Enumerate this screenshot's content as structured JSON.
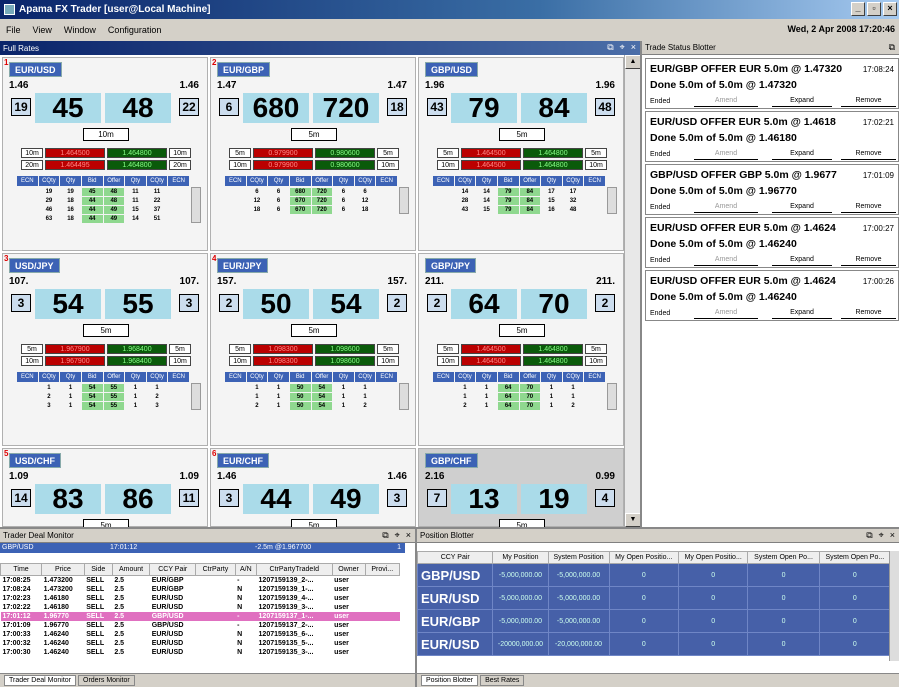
{
  "app": {
    "title": "Apama FX Trader [user@Local Machine]",
    "datetime": "Wed, 2 Apr 2008 17:20:46"
  },
  "menu": [
    "File",
    "View",
    "Window",
    "Configuration"
  ],
  "fullrates": {
    "title": "Full Rates",
    "tiles": [
      {
        "num": "1",
        "pair": "EUR/USD",
        "big_l": "1.46",
        "big_r": "1.46",
        "pip_l": "19",
        "bid": "45",
        "ask": "48",
        "pip_r": "22",
        "amount": "10m",
        "quotes": [
          [
            "10m",
            "1.464500",
            "1.464800",
            "10m"
          ],
          [
            "20m",
            "1.464495",
            "1.464800",
            "20m"
          ]
        ],
        "depth": [
          [
            "19",
            "19",
            "45",
            "48",
            "11",
            "11"
          ],
          [
            "29",
            "18",
            "44",
            "48",
            "11",
            "22"
          ],
          [
            "46",
            "16",
            "44",
            "49",
            "15",
            "37"
          ],
          [
            "63",
            "18",
            "44",
            "49",
            "14",
            "51"
          ]
        ],
        "gray": false
      },
      {
        "num": "2",
        "pair": "EUR/GBP",
        "big_l": "1.47",
        "big_r": "1.47",
        "pip_l": "6",
        "bid": "680",
        "ask": "720",
        "pip_r": "18",
        "amount": "5m",
        "quotes": [
          [
            "5m",
            "0.979900",
            "0.980600",
            "5m"
          ],
          [
            "10m",
            "0.979900",
            "0.980600",
            "10m"
          ]
        ],
        "depth": [
          [
            "6",
            "6",
            "680",
            "720",
            "6",
            "6"
          ],
          [
            "12",
            "6",
            "670",
            "720",
            "6",
            "12"
          ],
          [
            "18",
            "6",
            "670",
            "720",
            "6",
            "18"
          ]
        ],
        "gray": false
      },
      {
        "num": "",
        "pair": "GBP/USD",
        "big_l": "1.96",
        "big_r": "1.96",
        "pip_l": "43",
        "bid": "79",
        "ask": "84",
        "pip_r": "48",
        "amount": "5m",
        "quotes": [
          [
            "5m",
            "1.464500",
            "1.464800",
            "5m"
          ],
          [
            "10m",
            "1.464500",
            "1.464800",
            "10m"
          ]
        ],
        "depth": [
          [
            "14",
            "14",
            "79",
            "84",
            "17",
            "17"
          ],
          [
            "28",
            "14",
            "79",
            "84",
            "15",
            "32"
          ],
          [
            "43",
            "15",
            "79",
            "84",
            "16",
            "48"
          ]
        ],
        "gray": false
      },
      {
        "num": "3",
        "pair": "USD/JPY",
        "big_l": "107.",
        "big_r": "107.",
        "pip_l": "3",
        "bid": "54",
        "ask": "55",
        "pip_r": "3",
        "amount": "5m",
        "quotes": [
          [
            "5m",
            "1.967900",
            "1.968400",
            "5m"
          ],
          [
            "10m",
            "1.967900",
            "1.968400",
            "10m"
          ]
        ],
        "depth": [
          [
            "1",
            "1",
            "54",
            "55",
            "1",
            "1"
          ],
          [
            "2",
            "1",
            "54",
            "55",
            "1",
            "2"
          ],
          [
            "3",
            "1",
            "54",
            "55",
            "1",
            "3"
          ]
        ],
        "gray": false
      },
      {
        "num": "4",
        "pair": "EUR/JPY",
        "big_l": "157.",
        "big_r": "157.",
        "pip_l": "2",
        "bid": "50",
        "ask": "54",
        "pip_r": "2",
        "amount": "5m",
        "quotes": [
          [
            "5m",
            "1.098300",
            "1.098600",
            "5m"
          ],
          [
            "10m",
            "1.098300",
            "1.098600",
            "10m"
          ]
        ],
        "depth": [
          [
            "1",
            "1",
            "50",
            "54",
            "1",
            "1"
          ],
          [
            "1",
            "1",
            "50",
            "54",
            "1",
            "1"
          ],
          [
            "2",
            "1",
            "50",
            "54",
            "1",
            "2"
          ]
        ],
        "gray": false
      },
      {
        "num": "",
        "pair": "GBP/JPY",
        "big_l": "211.",
        "big_r": "211.",
        "pip_l": "2",
        "bid": "64",
        "ask": "70",
        "pip_r": "2",
        "amount": "5m",
        "quotes": [
          [
            "5m",
            "1.464500",
            "1.464800",
            "5m"
          ],
          [
            "10m",
            "1.464500",
            "1.464800",
            "10m"
          ]
        ],
        "depth": [
          [
            "1",
            "1",
            "64",
            "70",
            "1",
            "1"
          ],
          [
            "1",
            "1",
            "64",
            "70",
            "1",
            "1"
          ],
          [
            "2",
            "1",
            "64",
            "70",
            "1",
            "2"
          ]
        ],
        "gray": false
      },
      {
        "num": "5",
        "pair": "USD/CHF",
        "big_l": "1.09",
        "big_r": "1.09",
        "pip_l": "14",
        "bid": "83",
        "ask": "86",
        "pip_r": "11",
        "amount": "5m",
        "quotes": [],
        "depth": [],
        "gray": false
      },
      {
        "num": "6",
        "pair": "EUR/CHF",
        "big_l": "1.46",
        "big_r": "1.46",
        "pip_l": "3",
        "bid": "44",
        "ask": "49",
        "pip_r": "3",
        "amount": "5m",
        "quotes": [],
        "depth": [],
        "gray": false
      },
      {
        "num": "",
        "pair": "GBP/CHF",
        "big_l": "2.16",
        "big_r": "0.99",
        "pip_l": "7",
        "bid": "13",
        "ask": "19",
        "pip_r": "4",
        "amount": "5m",
        "quotes": [],
        "depth": [],
        "gray": true
      }
    ],
    "depth_headers": [
      "ECN",
      "CQty",
      "Qty",
      "Bid",
      "Offer",
      "Qty",
      "CQty",
      "ECN"
    ]
  },
  "blotter": {
    "title": "Trade Status Blotter",
    "trades": [
      {
        "line1": "EUR/GBP OFFER EUR 5.0m @ 1.47320",
        "time": "17:08:24",
        "line2": "Done 5.0m of 5.0m @ 1.47320",
        "status": "Ended",
        "amend": "Amend",
        "expand": "Expand",
        "remove": "Remove"
      },
      {
        "line1": "EUR/USD OFFER EUR 5.0m @ 1.4618",
        "time": "17:02:21",
        "line2": "Done 5.0m of 5.0m @ 1.46180",
        "status": "Ended",
        "amend": "Amend",
        "expand": "Expand",
        "remove": "Remove"
      },
      {
        "line1": "GBP/USD OFFER GBP 5.0m @ 1.9677",
        "time": "17:01:09",
        "line2": "Done 5.0m of 5.0m @ 1.96770",
        "status": "Ended",
        "amend": "Amend",
        "expand": "Expand",
        "remove": "Remove"
      },
      {
        "line1": "EUR/USD OFFER EUR 5.0m @ 1.4624",
        "time": "17:00:27",
        "line2": "Done 5.0m of 5.0m @ 1.46240",
        "status": "Ended",
        "amend": "Amend",
        "expand": "Expand",
        "remove": "Remove"
      },
      {
        "line1": "EUR/USD OFFER EUR 5.0m @ 1.4624",
        "time": "17:00:26",
        "line2": "Done 5.0m of 5.0m @ 1.46240",
        "status": "Ended",
        "amend": "Amend",
        "expand": "Expand",
        "remove": "Remove"
      }
    ]
  },
  "dealmon": {
    "title": "Trader Deal Monitor",
    "summary": {
      "pair": "GBP/USD",
      "time": "17:01:12",
      "pos": "-2.5m @1.967700",
      "count": "1"
    },
    "headers": [
      "Time",
      "Price",
      "Side",
      "Amount",
      "CCY Pair",
      "CtrParty",
      "A/N",
      "CtrPartyTradeId",
      "Owner",
      "Provi..."
    ],
    "rows": [
      [
        "17:08:25",
        "1.473200",
        "SELL",
        "2.5",
        "EUR/GBP",
        "",
        "-",
        "1207159139_2-...",
        "user",
        ""
      ],
      [
        "17:08:24",
        "1.473200",
        "SELL",
        "2.5",
        "EUR/GBP",
        "",
        "N",
        "1207159139_1-...",
        "user",
        ""
      ],
      [
        "17:02:23",
        "1.46180",
        "SELL",
        "2.5",
        "EUR/USD",
        "",
        "N",
        "1207159139_4-...",
        "user",
        ""
      ],
      [
        "17:02:22",
        "1.46180",
        "SELL",
        "2.5",
        "EUR/USD",
        "",
        "N",
        "1207159139_3-...",
        "user",
        ""
      ],
      [
        "17:01:12",
        "1.96770",
        "SELL",
        "2.5",
        "GBP/USD",
        "",
        "-",
        "1207159137_1-...",
        "user",
        ""
      ],
      [
        "17:01:09",
        "1.96770",
        "SELL",
        "2.5",
        "GBP/USD",
        "",
        "-",
        "1207159137_2-...",
        "user",
        ""
      ],
      [
        "17:00:33",
        "1.46240",
        "SELL",
        "2.5",
        "EUR/USD",
        "",
        "N",
        "1207159135_6-...",
        "user",
        ""
      ],
      [
        "17:00:32",
        "1.46240",
        "SELL",
        "2.5",
        "EUR/USD",
        "",
        "N",
        "1207159135_5-...",
        "user",
        ""
      ],
      [
        "17:00:30",
        "1.46240",
        "SELL",
        "2.5",
        "EUR/USD",
        "",
        "N",
        "1207159135_3-...",
        "user",
        ""
      ]
    ],
    "highlight_row": 4,
    "tabs": [
      "Trader Deal Monitor",
      "Orders Monitor"
    ]
  },
  "posblot": {
    "title": "Position Blotter",
    "headers": [
      "CCY Pair",
      "My Position",
      "System Position",
      "My Open Positio...",
      "My Open Positio...",
      "System Open Po...",
      "System Open Po..."
    ],
    "rows": [
      [
        "GBP/USD",
        "-5,000,000.00",
        "-5,000,000.00",
        "0",
        "0",
        "0",
        "0"
      ],
      [
        "EUR/USD",
        "-5,000,000.00",
        "-5,000,000.00",
        "0",
        "0",
        "0",
        "0"
      ],
      [
        "EUR/GBP",
        "-5,000,000.00",
        "-5,000,000.00",
        "0",
        "0",
        "0",
        "0"
      ],
      [
        "EUR/USD",
        "-20000,000.00",
        "-20,000,000.00",
        "0",
        "0",
        "0",
        "0"
      ]
    ],
    "tabs": [
      "Position Blotter",
      "Best Rates"
    ]
  }
}
